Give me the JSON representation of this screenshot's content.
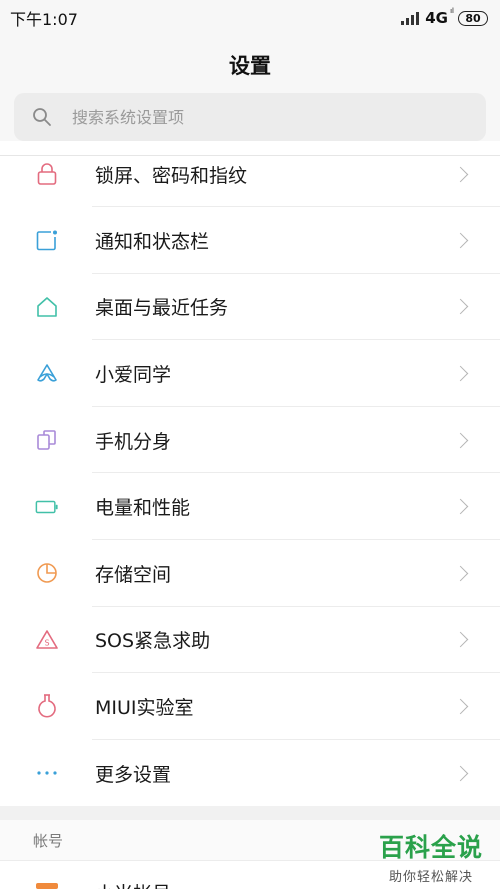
{
  "status_bar": {
    "time": "下午1:07",
    "network": "4G",
    "network_sup": "ᵢₗ",
    "battery": "80"
  },
  "page_title": "设置",
  "search": {
    "placeholder": "搜索系统设置项"
  },
  "settings_items": [
    {
      "label": "锁屏、密码和指纹",
      "icon": "lock-icon",
      "color": "#e36b7f"
    },
    {
      "label": "通知和状态栏",
      "icon": "notification-icon",
      "color": "#3aa0d8"
    },
    {
      "label": "桌面与最近任务",
      "icon": "home-icon",
      "color": "#41c0a8"
    },
    {
      "label": "小爱同学",
      "icon": "xiaoai-icon",
      "color": "#3aa0d8"
    },
    {
      "label": "手机分身",
      "icon": "second-space-icon",
      "color": "#a98ad8"
    },
    {
      "label": "电量和性能",
      "icon": "battery-icon",
      "color": "#41c0a8"
    },
    {
      "label": "存储空间",
      "icon": "storage-icon",
      "color": "#f09a52"
    },
    {
      "label": "SOS紧急求助",
      "icon": "sos-icon",
      "color": "#e36b7f"
    },
    {
      "label": "MIUI实验室",
      "icon": "lab-icon",
      "color": "#e36b7f"
    },
    {
      "label": "更多设置",
      "icon": "more-icon",
      "color": "#3aa0d8"
    }
  ],
  "section_header": "帐号",
  "partial_item": {
    "label": "小米帐号"
  },
  "watermark": {
    "title": "百科全说",
    "subtitle": "助你轻松解决"
  }
}
